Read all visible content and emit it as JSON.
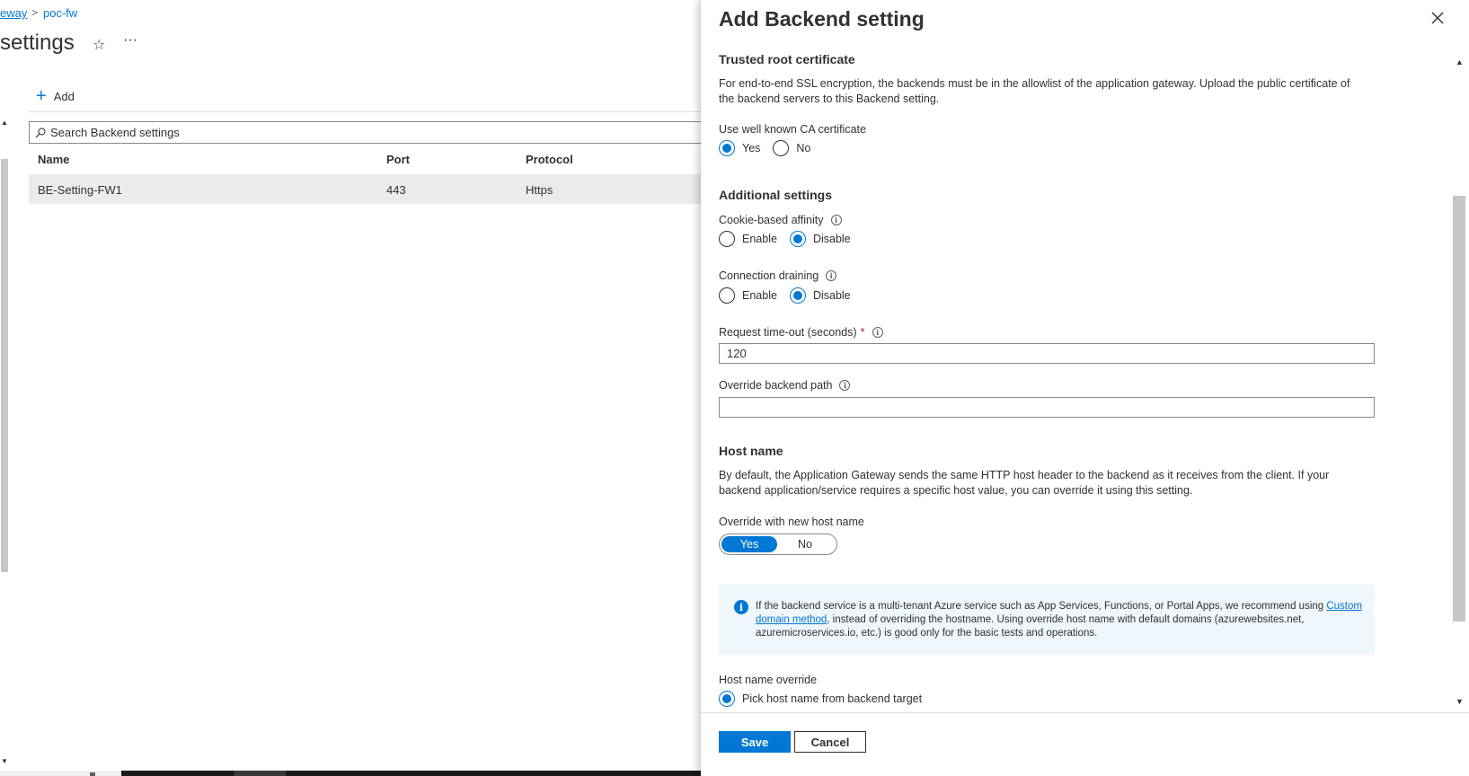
{
  "breadcrumb": {
    "parent": "eway",
    "current": "poc-fw",
    "separator": ">"
  },
  "page": {
    "title": "settings",
    "favorite_icon": "star-icon",
    "more_label": "···"
  },
  "toolbar": {
    "add_label": "Add"
  },
  "search": {
    "placeholder": "Search Backend settings"
  },
  "table": {
    "columns": [
      "Name",
      "Port",
      "Protocol"
    ],
    "rows": [
      {
        "name": "BE-Setting-FW1",
        "port": "443",
        "protocol": "Https"
      }
    ]
  },
  "blade": {
    "title": "Add Backend setting",
    "trusted_root": {
      "heading": "Trusted root certificate",
      "description": "For end-to-end SSL encryption, the backends must be in the allowlist of the application gateway. Upload the public certificate of the backend servers to this Backend setting.",
      "ca_label": "Use well known CA certificate",
      "yes": "Yes",
      "no": "No",
      "selected": "Yes"
    },
    "additional": {
      "heading": "Additional settings",
      "cookie_label": "Cookie-based affinity",
      "drain_label": "Connection draining",
      "enable": "Enable",
      "disable": "Disable",
      "cookie_selected": "Disable",
      "drain_selected": "Disable",
      "timeout_label": "Request time-out (seconds)",
      "required_mark": "*",
      "timeout_value": "120",
      "override_path_label": "Override backend path",
      "override_path_value": ""
    },
    "host": {
      "heading": "Host name",
      "description": "By default, the Application Gateway sends the same HTTP host header to the backend as it receives from the client. If your backend application/service requires a specific host value, you can override it using this setting.",
      "override_label": "Override with new host name",
      "toggle_yes": "Yes",
      "toggle_no": "No",
      "toggle_selected": "Yes",
      "info_prefix": "If the backend service is a multi-tenant Azure service such as App Services, Functions, or Portal Apps, we recommend using ",
      "info_link": "Custom domain method",
      "info_suffix": ", instead of overriding the hostname. Using override host name with default domains (azurewebsites.net, azuremicroservices.io, etc.) is good only for the basic tests and operations.",
      "override_host_label": "Host name override",
      "pick_option": "Pick host name from backend target"
    },
    "footer": {
      "save": "Save",
      "cancel": "Cancel"
    }
  },
  "colors": {
    "accent": "#0078d4",
    "info_bg": "#eff6fc",
    "required": "#a4262c"
  }
}
